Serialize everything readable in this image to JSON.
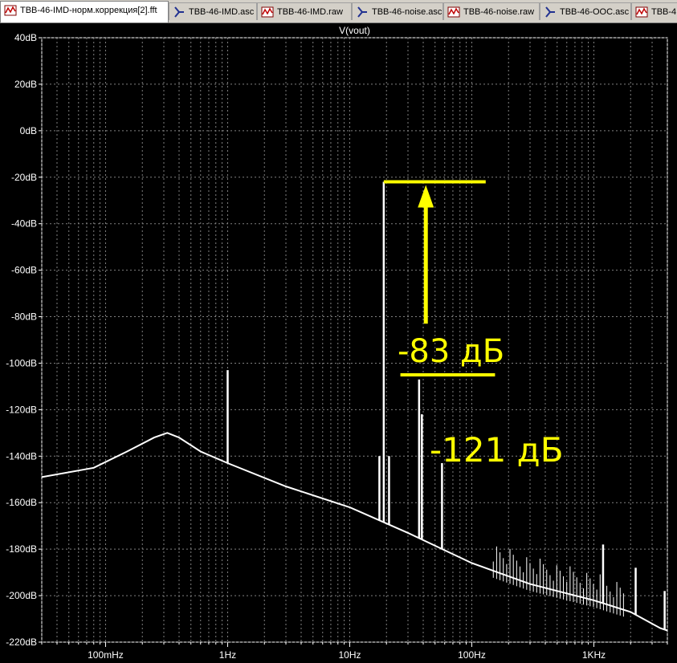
{
  "tabs": [
    {
      "label": "TBB-46-IMD-норм.коррекция[2].fft",
      "icon": "waveform-icon",
      "active": true
    },
    {
      "label": "TBB-46-IMD.asc",
      "icon": "schematic-icon",
      "active": false
    },
    {
      "label": "TBB-46-IMD.raw",
      "icon": "waveform-icon",
      "active": false
    },
    {
      "label": "TBB-46-noise.asc",
      "icon": "schematic-icon",
      "active": false
    },
    {
      "label": "TBB-46-noise.raw",
      "icon": "waveform-icon",
      "active": false
    },
    {
      "label": "TBB-46-OOC.asc",
      "icon": "schematic-icon",
      "active": false
    },
    {
      "label": "TBB-4",
      "icon": "waveform-icon",
      "active": false
    }
  ],
  "chart_data": {
    "type": "line",
    "title": "V(vout)",
    "xscale": "log",
    "xlim": [
      0.03,
      4
    ],
    "ylim": [
      -220,
      40
    ],
    "x_ticks": [
      {
        "value": 0.1,
        "label": "100mHz"
      },
      {
        "value": 1,
        "label": "1Hz"
      },
      {
        "value": 10,
        "label": "10Hz"
      },
      {
        "value": 100,
        "label": "100Hz"
      },
      {
        "value": 1000,
        "label": "1KHz"
      }
    ],
    "y_ticks": [
      {
        "value": 40,
        "label": "40dB"
      },
      {
        "value": 20,
        "label": "20dB"
      },
      {
        "value": 0,
        "label": "0dB"
      },
      {
        "value": -20,
        "label": "-20dB"
      },
      {
        "value": -40,
        "label": "-40dB"
      },
      {
        "value": -60,
        "label": "-60dB"
      },
      {
        "value": -80,
        "label": "-80dB"
      },
      {
        "value": -100,
        "label": "-100dB"
      },
      {
        "value": -120,
        "label": "-120dB"
      },
      {
        "value": -140,
        "label": "-140dB"
      },
      {
        "value": -160,
        "label": "-160dB"
      },
      {
        "value": -180,
        "label": "-180dB"
      },
      {
        "value": -200,
        "label": "-200dB"
      },
      {
        "value": -220,
        "label": "-220dB"
      }
    ],
    "grid": true,
    "colors": {
      "background": "#000000",
      "trace": "#ffffff",
      "grid": "#808080",
      "annotation": "#ffff00"
    },
    "noise_floor": [
      {
        "x": 0.03,
        "y": -149
      },
      {
        "x": 0.08,
        "y": -145
      },
      {
        "x": 0.15,
        "y": -138
      },
      {
        "x": 0.25,
        "y": -132
      },
      {
        "x": 0.32,
        "y": -130
      },
      {
        "x": 0.4,
        "y": -132
      },
      {
        "x": 0.6,
        "y": -138
      },
      {
        "x": 1,
        "y": -143
      },
      {
        "x": 3,
        "y": -153
      },
      {
        "x": 10,
        "y": -162
      },
      {
        "x": 30,
        "y": -173
      },
      {
        "x": 100,
        "y": -186
      },
      {
        "x": 300,
        "y": -195
      },
      {
        "x": 1000,
        "y": -202
      },
      {
        "x": 2000,
        "y": -207
      },
      {
        "x": 3500,
        "y": -214
      },
      {
        "x": 4000,
        "y": -215
      }
    ],
    "spurs": [
      {
        "x": 1.0,
        "y": -103
      },
      {
        "x": 17.5,
        "y": -140
      },
      {
        "x": 19,
        "y": -22
      },
      {
        "x": 21,
        "y": -140
      },
      {
        "x": 37,
        "y": -107
      },
      {
        "x": 39,
        "y": -122
      },
      {
        "x": 57,
        "y": -143
      },
      {
        "x": 76,
        "y": -183
      },
      {
        "x": 1190,
        "y": -178
      },
      {
        "x": 2200,
        "y": -188
      },
      {
        "x": 3800,
        "y": -198
      }
    ],
    "annotations": [
      {
        "text": "-83 дБ"
      },
      {
        "text": "-121 дБ"
      }
    ]
  }
}
